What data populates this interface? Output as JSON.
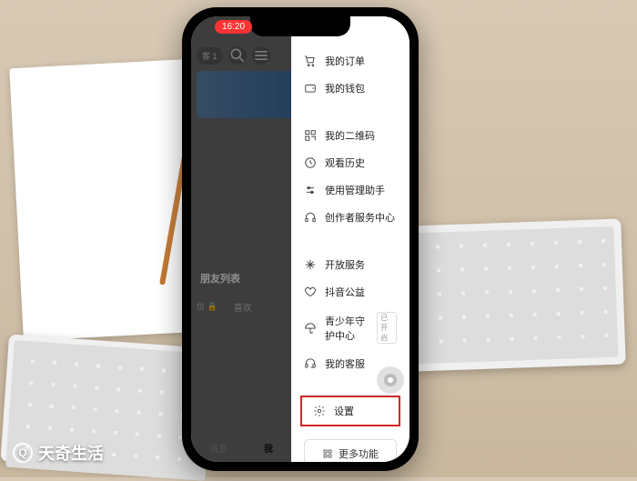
{
  "status": {
    "time": "16:20"
  },
  "app": {
    "header_badge": "客 1",
    "friends_title": "朋友列表",
    "tabs": [
      "位 🔒",
      "喜欢"
    ],
    "bottom_nav": {
      "messages": "消息",
      "me": "我"
    }
  },
  "drawer": {
    "group1": [
      {
        "icon": "cart",
        "label": "我的订单"
      },
      {
        "icon": "wallet",
        "label": "我的钱包"
      }
    ],
    "group2": [
      {
        "icon": "qr",
        "label": "我的二维码"
      },
      {
        "icon": "clock",
        "label": "观看历史"
      },
      {
        "icon": "sliders",
        "label": "使用管理助手"
      },
      {
        "icon": "headset",
        "label": "创作者服务中心"
      }
    ],
    "group3": [
      {
        "icon": "spark",
        "label": "开放服务"
      },
      {
        "icon": "heart",
        "label": "抖音公益"
      },
      {
        "icon": "shield",
        "label": "青少年守护中心",
        "badge": "已开启"
      },
      {
        "icon": "support",
        "label": "我的客服"
      }
    ],
    "settings": {
      "icon": "gear",
      "label": "设置"
    },
    "more": "更多功能"
  },
  "watermark": "天奇生活"
}
